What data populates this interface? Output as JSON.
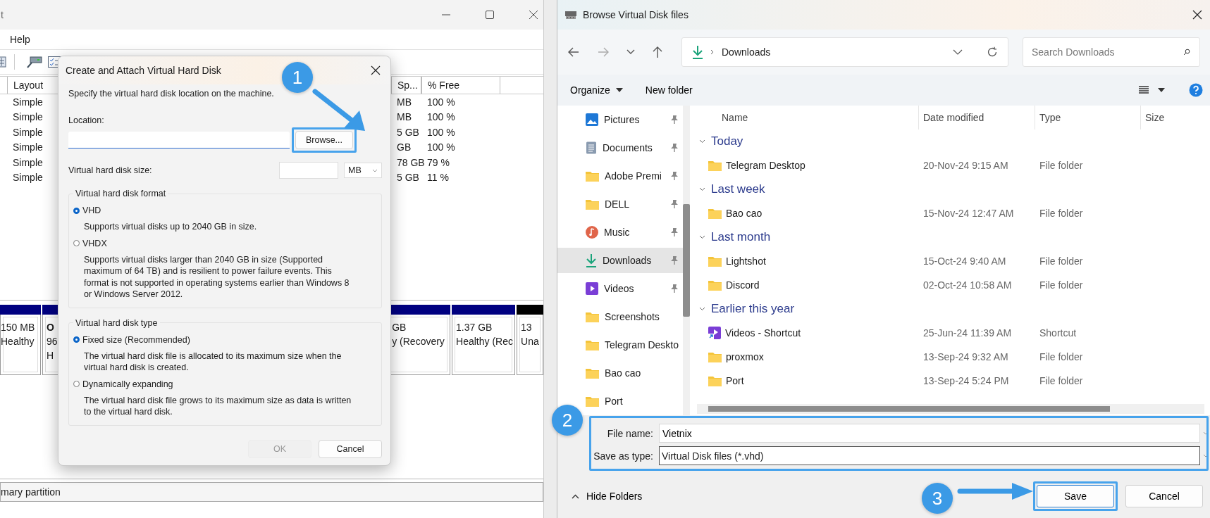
{
  "disk_management": {
    "title": "t",
    "menu": [
      "Help"
    ],
    "columns": [
      "Layout",
      "Sp...",
      "% Free"
    ],
    "volumes": [
      {
        "layout": "Simple",
        "free_space": "MB",
        "percent_free": "100 %"
      },
      {
        "layout": "Simple",
        "free_space": "MB",
        "percent_free": "100 %"
      },
      {
        "layout": "Simple",
        "free_space": "5 GB",
        "percent_free": "100 %"
      },
      {
        "layout": "Simple",
        "free_space": "GB",
        "percent_free": "100 %"
      },
      {
        "layout": "Simple",
        "free_space": "78 GB",
        "percent_free": "79 %"
      },
      {
        "layout": "Simple",
        "free_space": "5 GB",
        "percent_free": "11 %"
      }
    ],
    "partitions": [
      {
        "size": "150 MB",
        "status": "Healthy",
        "color": "#000080"
      },
      {
        "name": "O",
        "size": "96",
        "status": "H",
        "color": "#000080"
      },
      {
        "size": "GB",
        "status": "y (Recovery",
        "color": "#000080"
      },
      {
        "size": "1.37 GB",
        "status": "Healthy (Rec",
        "color": "#000080"
      },
      {
        "size": "13",
        "status": "Una",
        "color": "#000000"
      }
    ],
    "status_bar": "mary partition"
  },
  "create_dialog": {
    "title": "Create and Attach Virtual Hard Disk",
    "intro": "Specify the virtual hard disk location on the machine.",
    "location_label": "Location:",
    "browse_button": "Browse...",
    "size_label": "Virtual hard disk size:",
    "size_unit": "MB",
    "groups": [
      {
        "legend": "Virtual hard disk format",
        "options": [
          {
            "label": "VHD",
            "selected": true,
            "description": "Supports virtual disks up to 2040 GB in size."
          },
          {
            "label": "VHDX",
            "selected": false,
            "description": "Supports virtual disks larger than 2040 GB in size (Supported maximum of 64 TB) and is resilient to power failure events. This format is not supported in operating systems earlier than Windows 8 or Windows Server 2012."
          }
        ]
      },
      {
        "legend": "Virtual hard disk type",
        "options": [
          {
            "label": "Fixed size (Recommended)",
            "selected": true,
            "description": "The virtual hard disk file is allocated to its maximum size when the virtual hard disk is created."
          },
          {
            "label": "Dynamically expanding",
            "selected": false,
            "description": "The virtual hard disk file grows to its maximum size as data is written to the virtual hard disk."
          }
        ]
      }
    ],
    "buttons": [
      {
        "label": "OK",
        "disabled": true
      },
      {
        "label": "Cancel",
        "disabled": false
      }
    ]
  },
  "browse_dialog": {
    "title": "Browse Virtual Disk files",
    "address": "Downloads",
    "search_placeholder": "Search Downloads",
    "toolbar": [
      {
        "label": "Organize",
        "kind": "menu"
      },
      {
        "label": "New folder",
        "kind": "button"
      }
    ],
    "nav_items": [
      {
        "label": "Pictures",
        "kind": "pictures",
        "pinned": true,
        "selected": false
      },
      {
        "label": "Documents",
        "kind": "documents",
        "pinned": true,
        "selected": false
      },
      {
        "label": "Adobe Premi",
        "kind": "folder",
        "pinned": true,
        "selected": false
      },
      {
        "label": "DELL",
        "kind": "folder",
        "pinned": true,
        "selected": false
      },
      {
        "label": "Music",
        "kind": "music",
        "pinned": true,
        "selected": false
      },
      {
        "label": "Downloads",
        "kind": "downloads",
        "pinned": true,
        "selected": true
      },
      {
        "label": "Videos",
        "kind": "videos",
        "pinned": true,
        "selected": false
      },
      {
        "label": "Screenshots",
        "kind": "folder",
        "pinned": false,
        "selected": false
      },
      {
        "label": "Telegram Deskto",
        "kind": "folder",
        "pinned": false,
        "selected": false
      },
      {
        "label": "Bao cao",
        "kind": "folder",
        "pinned": false,
        "selected": false
      },
      {
        "label": "Port",
        "kind": "folder",
        "pinned": false,
        "selected": false
      }
    ],
    "columns": [
      "Name",
      "Date modified",
      "Type",
      "Size"
    ],
    "groups": [
      {
        "title": "Today",
        "expanded": true,
        "files": [
          {
            "name": "Telegram Desktop",
            "kind": "folder",
            "date": "20-Nov-24 9:15 AM",
            "type": "File folder"
          }
        ]
      },
      {
        "title": "Last week",
        "expanded": true,
        "files": [
          {
            "name": "Bao cao",
            "kind": "folder",
            "date": "15-Nov-24 12:47 AM",
            "type": "File folder"
          }
        ]
      },
      {
        "title": "Last month",
        "expanded": true,
        "files": [
          {
            "name": "Lightshot",
            "kind": "folder",
            "date": "15-Oct-24 9:40 AM",
            "type": "File folder"
          },
          {
            "name": "Discord",
            "kind": "folder",
            "date": "02-Oct-24 10:58 AM",
            "type": "File folder"
          }
        ]
      },
      {
        "title": "Earlier this year",
        "expanded": true,
        "files": [
          {
            "name": "Videos - Shortcut",
            "kind": "shortcut",
            "date": "25-Jun-24 11:39 AM",
            "type": "Shortcut"
          },
          {
            "name": "proxmox",
            "kind": "folder",
            "date": "13-Sep-24 9:32 AM",
            "type": "File folder"
          },
          {
            "name": "Port",
            "kind": "folder",
            "date": "13-Sep-24 5:24 PM",
            "type": "File folder"
          }
        ]
      }
    ],
    "file_name_label": "File name:",
    "file_name": "Vietnix",
    "type_label": "Save as type:",
    "type_value": "Virtual Disk files (*.vhd)",
    "hide_folders": "Hide Folders",
    "buttons": [
      "Save",
      "Cancel"
    ]
  },
  "callouts": [
    "1",
    "2",
    "3"
  ]
}
